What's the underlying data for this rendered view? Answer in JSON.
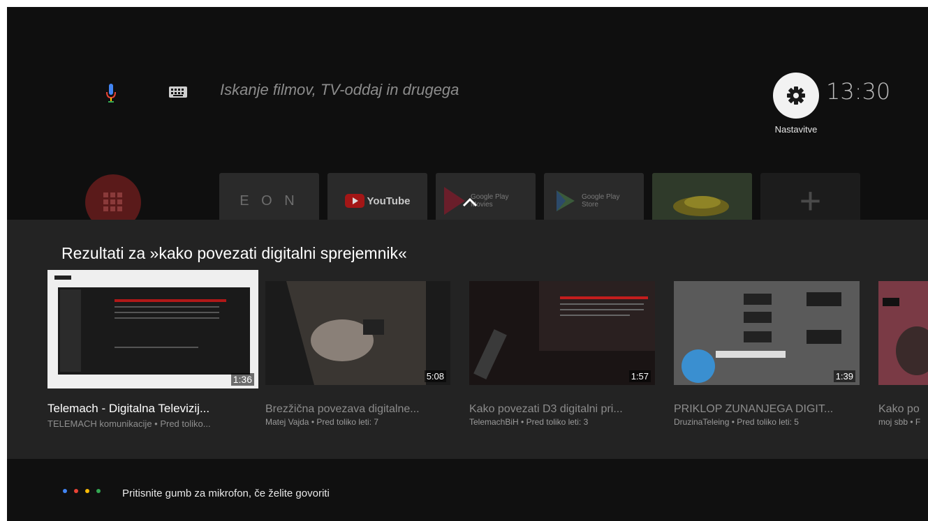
{
  "search": {
    "placeholder": "Iskanje filmov, TV-oddaj in drugega",
    "mic_icon": "mic-icon",
    "keyboard_icon": "keyboard-icon"
  },
  "header": {
    "settings_label": "Nastavitve",
    "clock": "13:30"
  },
  "apps": [
    {
      "name": "EON",
      "label": "E O N",
      "color": "#6d6d6d"
    },
    {
      "name": "YouTube",
      "label": "YouTube",
      "color": "#ffffff"
    },
    {
      "name": "Google Play Movies",
      "label": "Google Play Movies",
      "color": "#9e9e9e"
    },
    {
      "name": "Google Play Store",
      "label": "Google Play Store",
      "color": "#9e9e9e"
    },
    {
      "name": "Asphalt",
      "label": "",
      "color": "#c9b53a"
    },
    {
      "name": "Add",
      "label": "+",
      "color": "#555555"
    }
  ],
  "results": {
    "title": "Rezultati za »kako povezati digitalni sprejemnik«",
    "videos": [
      {
        "title": "Telemach - Digitalna Televizij...",
        "meta": "TELEMACH komunikacije • Pred toliko...",
        "duration": "1:36",
        "selected": true
      },
      {
        "title": "Brezžična povezava digitalne...",
        "meta": "Matej Vajda • Pred toliko leti: 7",
        "duration": "5:08",
        "selected": false
      },
      {
        "title": "Kako povezati D3 digitalni pri...",
        "meta": "TelemachBiH • Pred toliko leti: 3",
        "duration": "1:57",
        "selected": false
      },
      {
        "title": "PRIKLOP ZUNANJEGA DIGIT...",
        "meta": "DruzinaTeleing • Pred toliko leti: 5",
        "duration": "1:39",
        "selected": false
      },
      {
        "title": "Kako po",
        "meta": "moj sbb • F",
        "duration": "",
        "selected": false
      }
    ]
  },
  "hint": {
    "text": "Pritisnite gumb za mikrofon, če želite govoriti",
    "dot_colors": [
      "#4285f4",
      "#ea4335",
      "#fbbc05",
      "#34a853"
    ]
  }
}
